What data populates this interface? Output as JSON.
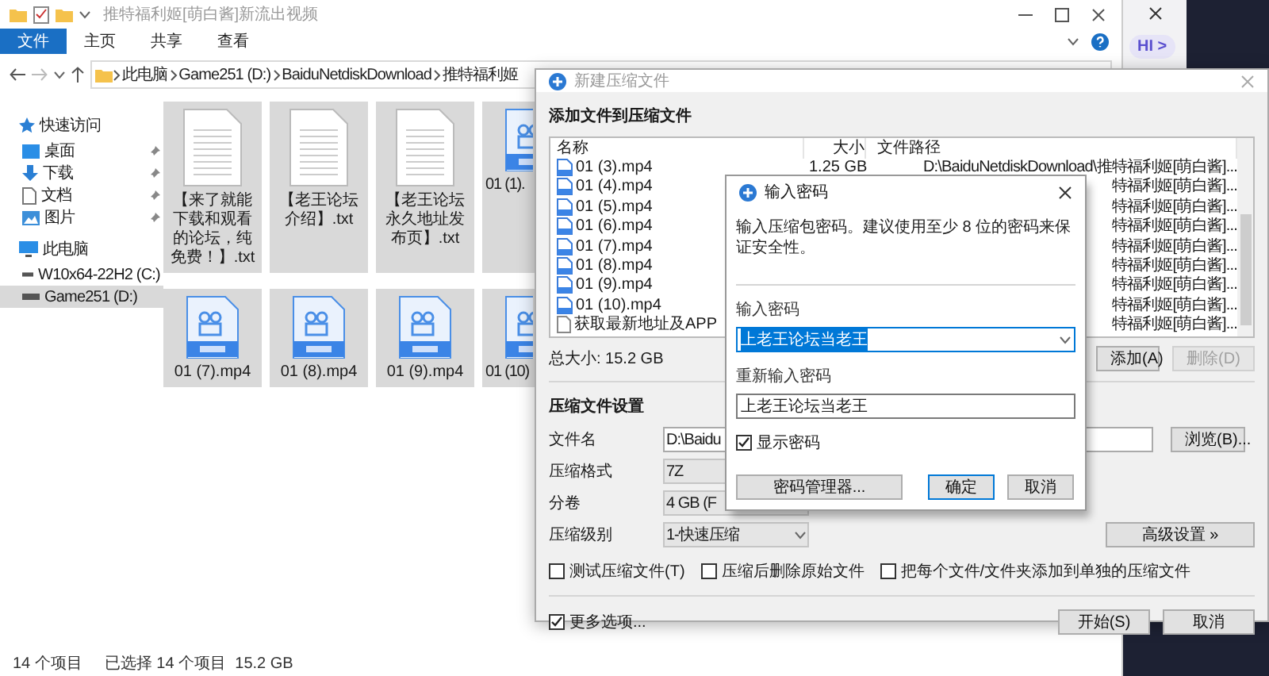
{
  "explorer": {
    "title": "推特福利姬[萌白酱]新流出视频",
    "ribbon_tabs": [
      {
        "label": "文件",
        "selected": true
      },
      {
        "label": "主页",
        "selected": false
      },
      {
        "label": "共享",
        "selected": false
      },
      {
        "label": "查看",
        "selected": false
      }
    ],
    "address": [
      "此电脑",
      "Game251 (D:)",
      "BaiduNetdiskDownload",
      "推特福利姬"
    ],
    "sidebar": [
      {
        "label": "快速访问",
        "selected": false,
        "children": [
          {
            "label": "桌面",
            "pinned": true,
            "selected": false
          },
          {
            "label": "下载",
            "pinned": true,
            "selected": false
          },
          {
            "label": "文档",
            "pinned": true,
            "selected": false
          },
          {
            "label": "图片",
            "pinned": true,
            "selected": false
          }
        ]
      },
      {
        "label": "此电脑",
        "selected": false,
        "children": [
          {
            "label": "W10x64-22H2 (C:)",
            "selected": false
          },
          {
            "label": "Game251 (D:)",
            "selected": true
          }
        ]
      }
    ],
    "files": [
      {
        "name": "【来了就能下载和观看的论坛，纯免费！】.txt",
        "kind": "txt",
        "selected": true,
        "clipped": false
      },
      {
        "name": "【老王论坛介绍】.txt",
        "kind": "txt",
        "selected": true,
        "clipped": false
      },
      {
        "name": "【老王论坛永久地址发布页】.txt",
        "kind": "txt",
        "selected": true,
        "clipped": false
      },
      {
        "name": "01 (1).",
        "kind": "mp4",
        "selected": true,
        "clipped": true
      },
      {
        "name": "01 (7).mp4",
        "kind": "mp4",
        "selected": true,
        "clipped": false
      },
      {
        "name": "01 (8).mp4",
        "kind": "mp4",
        "selected": true,
        "clipped": false
      },
      {
        "name": "01 (9).mp4",
        "kind": "mp4",
        "selected": true,
        "clipped": false
      },
      {
        "name": "01 (10)",
        "kind": "mp4",
        "selected": true,
        "clipped": true
      }
    ],
    "status": [
      "14 个项目",
      "已选择 14 个项目  15.2 GB"
    ]
  },
  "assistant_chip": "HI >",
  "compress_dialog": {
    "title": "新建压缩文件",
    "files_title": "添加文件到压缩文件",
    "columns": [
      "名称",
      "大小",
      "文件路径"
    ],
    "rows": [
      {
        "name": "01 (3).mp4",
        "size": "1.25 GB",
        "path": "D:\\BaiduNetdiskDownload\\推特福利姬[萌白酱]...",
        "kind": "video"
      },
      {
        "name": "01 (4).mp4",
        "path": "特福利姬[萌白酱]...",
        "kind": "video"
      },
      {
        "name": "01 (5).mp4",
        "path": "特福利姬[萌白酱]...",
        "kind": "video"
      },
      {
        "name": "01 (6).mp4",
        "path": "特福利姬[萌白酱]...",
        "kind": "video"
      },
      {
        "name": "01 (7).mp4",
        "path": "特福利姬[萌白酱]...",
        "kind": "video"
      },
      {
        "name": "01 (8).mp4",
        "path": "特福利姬[萌白酱]...",
        "kind": "video"
      },
      {
        "name": "01 (9).mp4",
        "path": "特福利姬[萌白酱]...",
        "kind": "video"
      },
      {
        "name": "01 (10).mp4",
        "path": "特福利姬[萌白酱]...",
        "kind": "video"
      },
      {
        "name": "获取最新地址及APP",
        "path": "特福利姬[萌白酱]...",
        "kind": "text"
      }
    ],
    "total": "总大小: 15.2 GB",
    "list_buttons": [
      {
        "label": "添加(A)",
        "disabled": false
      },
      {
        "label": "删除(D)",
        "disabled": true
      }
    ],
    "settings_title": "压缩文件设置",
    "fields": [
      {
        "label": "文件名",
        "value": "D:\\Baidu",
        "kind": "text"
      },
      {
        "label": "压缩格式",
        "value": "7Z",
        "kind": "select"
      },
      {
        "label": "分卷",
        "value": "4 GB (F",
        "kind": "select"
      },
      {
        "label": "压缩级别",
        "value": "1-快速压缩",
        "kind": "select"
      }
    ],
    "browse_button": "浏览(B)...",
    "advanced_button": "高级设置 »",
    "options": [
      {
        "label": "测试压缩文件(T)",
        "checked": false
      },
      {
        "label": "压缩后删除原始文件",
        "checked": false
      },
      {
        "label": "把每个文件/文件夹添加到单独的压缩文件",
        "checked": false
      }
    ],
    "more_options": {
      "label": "更多选项...",
      "checked": true
    },
    "buttons": [
      "开始(S)",
      "取消"
    ]
  },
  "password_dialog": {
    "title": "输入密码",
    "description": "输入压缩包密码。建议使用至少 8 位的密码来保证安全性。",
    "password_label": "输入密码",
    "password": "上老王论坛当老王",
    "password_selected": true,
    "confirm_label": "重新输入密码",
    "confirm": "上老王论坛当老王",
    "show_password": {
      "label": "显示密码",
      "checked": true
    },
    "buttons": [
      {
        "label": "密码管理器...",
        "default": false
      },
      {
        "label": "确定",
        "default": true
      },
      {
        "label": "取消",
        "default": false
      }
    ]
  }
}
